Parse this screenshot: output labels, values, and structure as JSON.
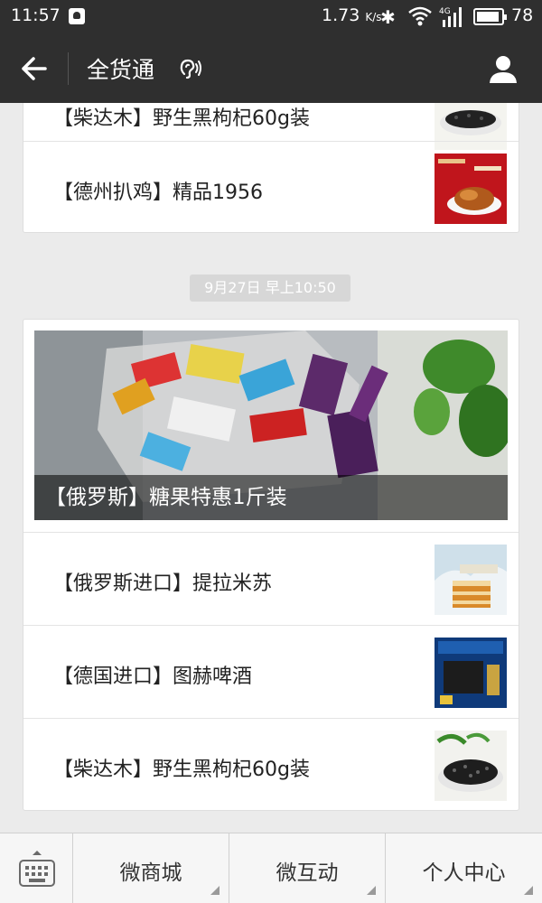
{
  "status_bar": {
    "time": "11:57",
    "net_speed": "1.73",
    "net_speed_unit": "K/s",
    "network_type": "4G",
    "battery_level": "78"
  },
  "nav": {
    "title": "全货通"
  },
  "feed": {
    "top_card": {
      "items": [
        {
          "label": "【柴达木】野生黑枸杞60g装",
          "thumb": "goji-berries"
        },
        {
          "label": "【德州扒鸡】精品1956",
          "thumb": "braised-chicken-box"
        }
      ]
    },
    "timestamp": "9月27日 早上10:50",
    "news_card": {
      "hero_caption": "【俄罗斯】糖果特惠1斤装",
      "items": [
        {
          "label": "【俄罗斯进口】提拉米苏",
          "thumb": "tiramisu-cake"
        },
        {
          "label": "【德国进口】图赫啤酒",
          "thumb": "beer-gift-box"
        },
        {
          "label": "【柴达木】野生黑枸杞60g装",
          "thumb": "goji-berries"
        }
      ]
    }
  },
  "bottom_menu": {
    "items": [
      {
        "label": "微商城"
      },
      {
        "label": "微互动"
      },
      {
        "label": "个人中心"
      }
    ]
  },
  "colors": {
    "bar": "#2f2f2f",
    "background": "#ebebeb",
    "timestamp_bg": "#d7d7d7"
  }
}
